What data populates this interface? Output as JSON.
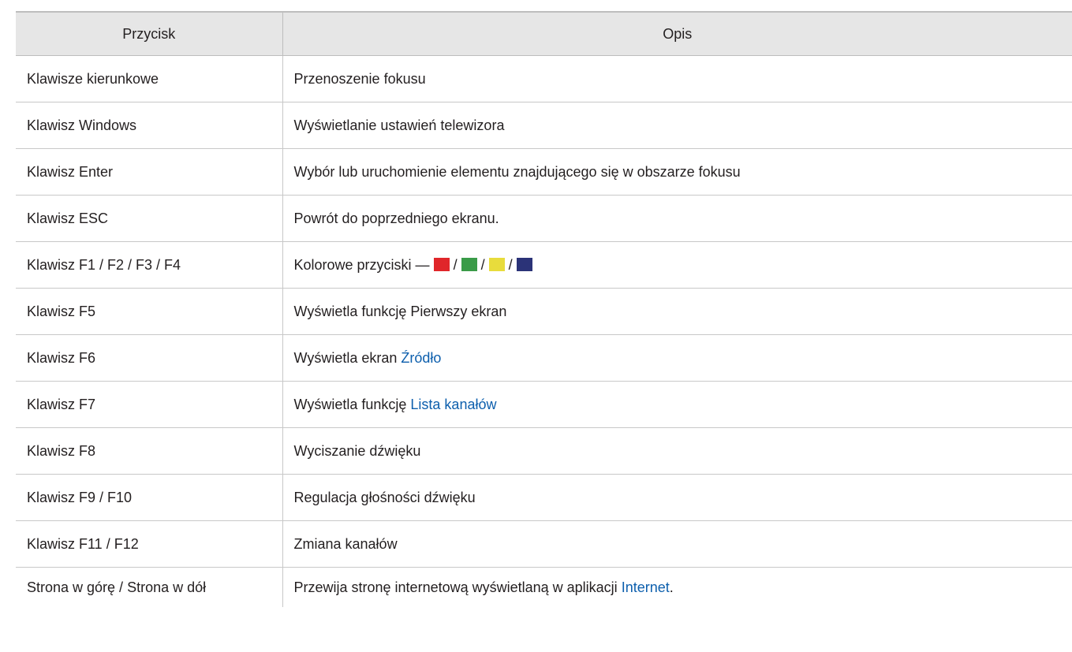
{
  "header": {
    "col1": "Przycisk",
    "col2": "Opis"
  },
  "rows": [
    {
      "key": "Klawisze kierunkowe",
      "desc": "Przenoszenie fokusu"
    },
    {
      "key": "Klawisz Windows",
      "desc": "Wyświetlanie ustawień telewizora"
    },
    {
      "key": "Klawisz Enter",
      "desc": "Wybór lub uruchomienie elementu znajdującego się w obszarze fokusu"
    },
    {
      "key": "Klawisz ESC",
      "desc": "Powrót do poprzedniego ekranu."
    },
    {
      "key": "Klawisz F1 / F2 / F3 / F4",
      "desc_prefix": "Kolorowe przyciski —",
      "separator": "/",
      "swatches": [
        "#e0262a",
        "#3a9b48",
        "#e8dc3c",
        "#2b3378"
      ]
    },
    {
      "key": "Klawisz F5",
      "desc": "Wyświetla funkcję Pierwszy ekran"
    },
    {
      "key": "Klawisz F6",
      "desc_prefix": "Wyświetla ekran",
      "link": "Źródło"
    },
    {
      "key": "Klawisz F7",
      "desc_prefix": "Wyświetla funkcję",
      "link": "Lista kanałów"
    },
    {
      "key": "Klawisz F8",
      "desc": "Wyciszanie dźwięku"
    },
    {
      "key": "Klawisz F9 / F10",
      "desc": "Regulacja głośności dźwięku"
    },
    {
      "key": "Klawisz F11 / F12",
      "desc": "Zmiana kanałów"
    },
    {
      "key": "Strona w górę / Strona w dół",
      "desc_prefix": "Przewija stronę internetową wyświetlaną w aplikacji",
      "link": "Internet",
      "desc_suffix": "."
    }
  ],
  "colors": {
    "link": "#0d5fad",
    "header_bg": "#e6e6e6",
    "text": "#231f20"
  }
}
